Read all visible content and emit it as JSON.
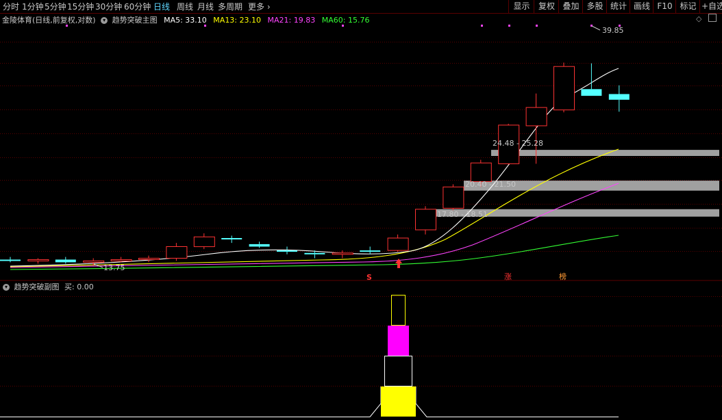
{
  "toolbar": {
    "periods": [
      "分时",
      "1分钟",
      "5分钟",
      "15分钟",
      "30分钟",
      "60分钟",
      "日线",
      "周线",
      "月线",
      "多周期",
      "更多"
    ],
    "active_period": "日线",
    "more_arrow": "›",
    "right_buttons": [
      "显示",
      "复权",
      "叠加",
      "多股",
      "统计",
      "画线",
      "F10",
      "标记",
      "+自选"
    ]
  },
  "main": {
    "title": "金陵体育(日线,前复权,对数)",
    "indicator_name": "趋势突破主图",
    "ma": [
      {
        "label": "MA5: 33.10",
        "color": "#ffffff"
      },
      {
        "label": "MA13: 23.10",
        "color": "#ffff00"
      },
      {
        "label": "MA21: 19.83",
        "color": "#ff44ff"
      },
      {
        "label": "MA60: 15.76",
        "color": "#33ff33"
      }
    ],
    "diamond_icon": "◇",
    "high_label": "39.85",
    "low_label": "13.75",
    "zones": [
      "24.48 - 25.28",
      "20.40 - 21.50",
      "17.80 - 18.51"
    ],
    "markers": {
      "s": "S",
      "zhang": "涨",
      "bang": "榜"
    }
  },
  "sub": {
    "indicator_name": "趋势突破副图",
    "buy_label": "买: 0.00"
  },
  "colors": {
    "up": "#ff3333",
    "down": "#54ffff",
    "ma5": "#ffffff",
    "ma13": "#ffff00",
    "ma21": "#ff44ff",
    "ma60": "#33ff33",
    "grid": "#5a0000",
    "zone": "#a0a0a0",
    "yellow": "#ffff00",
    "magenta": "#ff00ff"
  },
  "chart_data": {
    "type": "candlestick",
    "scale": "log",
    "series": [
      {
        "name": "MA5",
        "value": 33.1
      },
      {
        "name": "MA13",
        "value": 23.1
      },
      {
        "name": "MA21",
        "value": 19.83
      },
      {
        "name": "MA60",
        "value": 15.76
      }
    ],
    "candles": [
      {
        "o": 14.2,
        "h": 14.4,
        "l": 14.0,
        "c": 14.1
      },
      {
        "o": 14.1,
        "h": 14.3,
        "l": 13.9,
        "c": 14.2
      },
      {
        "o": 14.2,
        "h": 14.4,
        "l": 13.9,
        "c": 14.0
      },
      {
        "o": 14.0,
        "h": 14.3,
        "l": 13.75,
        "c": 14.1
      },
      {
        "o": 14.1,
        "h": 14.4,
        "l": 14.0,
        "c": 14.2
      },
      {
        "o": 14.2,
        "h": 14.5,
        "l": 14.0,
        "c": 14.3
      },
      {
        "o": 14.3,
        "h": 15.5,
        "l": 14.1,
        "c": 15.2
      },
      {
        "o": 15.2,
        "h": 16.3,
        "l": 15.0,
        "c": 16.0
      },
      {
        "o": 15.9,
        "h": 16.1,
        "l": 15.5,
        "c": 15.8
      },
      {
        "o": 15.4,
        "h": 15.6,
        "l": 15.1,
        "c": 15.2
      },
      {
        "o": 14.9,
        "h": 15.2,
        "l": 14.6,
        "c": 14.8
      },
      {
        "o": 14.7,
        "h": 14.9,
        "l": 14.3,
        "c": 14.6
      },
      {
        "o": 14.6,
        "h": 14.9,
        "l": 14.3,
        "c": 14.7
      },
      {
        "o": 14.9,
        "h": 15.2,
        "l": 14.6,
        "c": 14.8
      },
      {
        "o": 14.9,
        "h": 16.2,
        "l": 14.8,
        "c": 15.9
      },
      {
        "o": 16.6,
        "h": 18.8,
        "l": 16.2,
        "c": 18.5
      },
      {
        "o": 18.6,
        "h": 21.1,
        "l": 18.4,
        "c": 20.8
      },
      {
        "o": 21.4,
        "h": 24.0,
        "l": 20.8,
        "c": 23.6
      },
      {
        "o": 23.5,
        "h": 29.0,
        "l": 23.4,
        "c": 28.8
      },
      {
        "o": 28.7,
        "h": 34.0,
        "l": 23.5,
        "c": 31.6
      },
      {
        "o": 31.2,
        "h": 40.0,
        "l": 30.8,
        "c": 39.2
      },
      {
        "o": 34.8,
        "h": 39.85,
        "l": 34.0,
        "c": 33.6
      },
      {
        "o": 33.9,
        "h": 35.5,
        "l": 30.9,
        "c": 32.9
      }
    ],
    "zones": [
      {
        "low": 24.48,
        "high": 25.28
      },
      {
        "low": 20.4,
        "high": 21.5
      },
      {
        "low": 17.8,
        "high": 18.51
      }
    ],
    "high": 39.85,
    "low": 13.75,
    "buy": 0.0
  }
}
